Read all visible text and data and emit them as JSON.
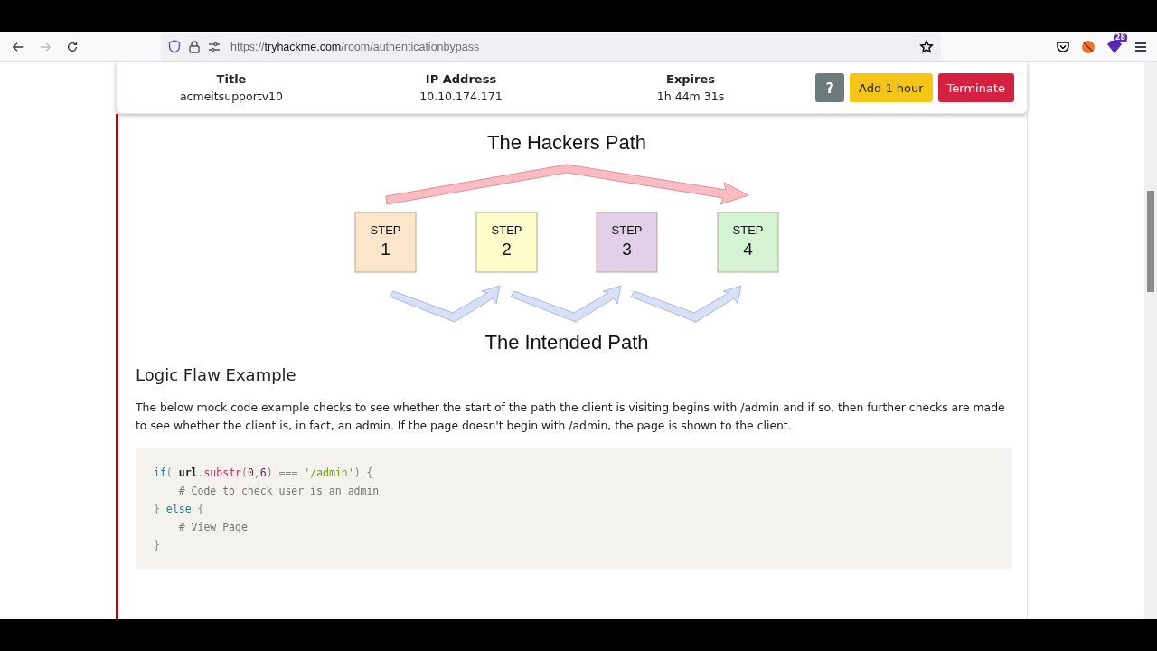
{
  "browser": {
    "back_disabled": false,
    "forward_disabled": true,
    "url": [
      {
        "text": "https://",
        "strong": false
      },
      {
        "text": "tryhackme.com",
        "strong": true
      },
      {
        "text": "/room/authenticationbypass",
        "strong": false
      }
    ],
    "extension_badge": "28"
  },
  "machine_bar": {
    "fields": [
      {
        "label": "Title",
        "value": "acmeitsupportv10"
      },
      {
        "label": "IP Address",
        "value": "10.10.174.171"
      },
      {
        "label": "Expires",
        "value": "1h 44m 31s"
      }
    ],
    "help_button": "?",
    "buttons": [
      {
        "label": "Add 1 hour",
        "kind": "warning"
      },
      {
        "label": "Terminate",
        "kind": "danger"
      }
    ]
  },
  "diagram": {
    "top_title": "The Hackers Path",
    "bottom_title": "The Intended Path",
    "steps": [
      {
        "label": "STEP",
        "number": "1",
        "color": "#fbe6cb"
      },
      {
        "label": "STEP",
        "number": "2",
        "color": "#fdfccb"
      },
      {
        "label": "STEP",
        "number": "3",
        "color": "#e2d0e8"
      },
      {
        "label": "STEP",
        "number": "4",
        "color": "#d4f4d4"
      }
    ]
  },
  "section": {
    "heading": "Logic Flaw Example",
    "paragraph": "The below mock code example checks to see whether the start of the path the client is visiting begins with /admin and if so, then further checks are made to see whether the client is, in fact, an admin. If the page doesn't begin with /admin, the page is shown to the client."
  },
  "code": [
    [
      {
        "text": "if",
        "kind": "keyword"
      },
      {
        "text": "( ",
        "kind": "punct"
      },
      {
        "text": "url",
        "kind": "plain"
      },
      {
        "text": ".",
        "kind": "punct"
      },
      {
        "text": "substr",
        "kind": "method"
      },
      {
        "text": "(",
        "kind": "punct"
      },
      {
        "text": "0",
        "kind": "number"
      },
      {
        "text": ",",
        "kind": "punct"
      },
      {
        "text": "6",
        "kind": "number"
      },
      {
        "text": ") ",
        "kind": "punct"
      },
      {
        "text": "=== ",
        "kind": "operator"
      },
      {
        "text": "'/admin'",
        "kind": "string"
      },
      {
        "text": ") {",
        "kind": "punct"
      }
    ],
    [
      {
        "text": "    # Code to check user is an admin",
        "kind": "comment"
      }
    ],
    [
      {
        "text": "} ",
        "kind": "punct"
      },
      {
        "text": "else",
        "kind": "keyword"
      },
      {
        "text": " {",
        "kind": "punct"
      }
    ],
    [
      {
        "text": "    # View Page",
        "kind": "comment"
      }
    ],
    [
      {
        "text": "}",
        "kind": "punct"
      }
    ]
  ]
}
